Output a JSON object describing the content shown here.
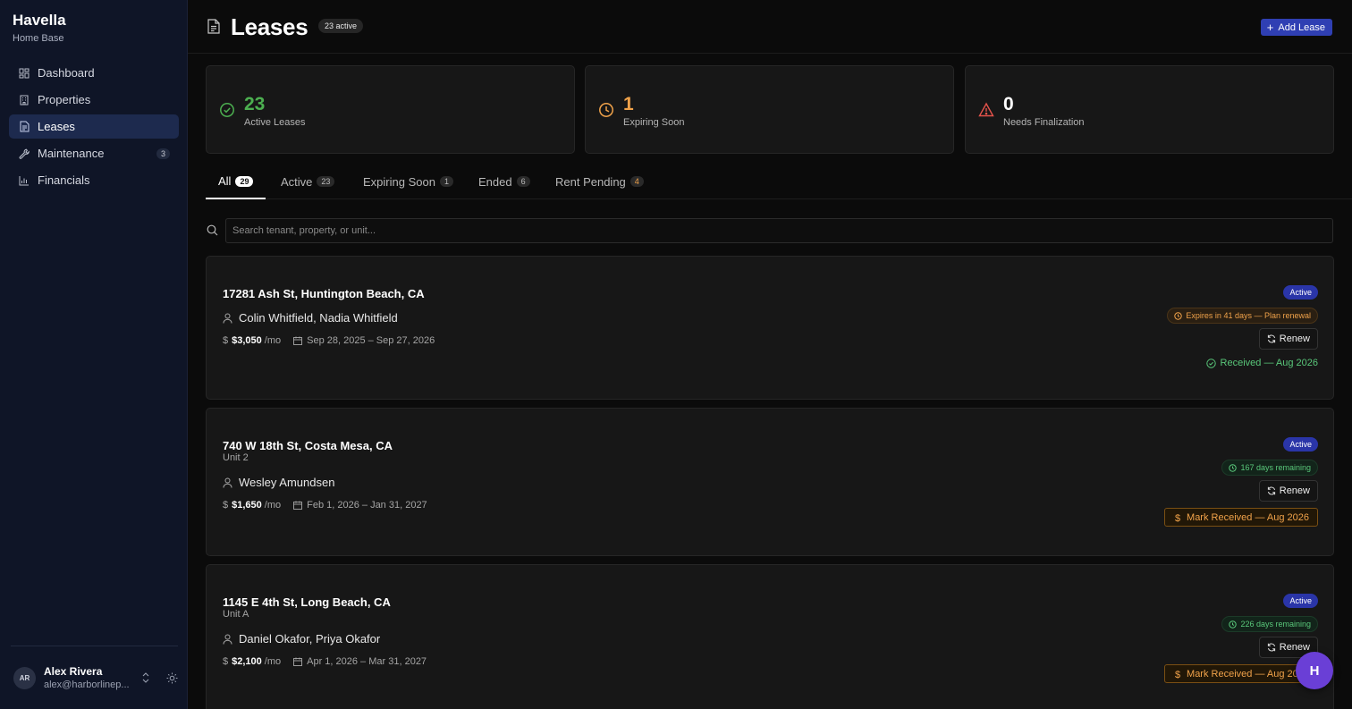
{
  "brand": {
    "name": "Havella",
    "subtitle": "Home Base"
  },
  "sidebar": {
    "items": [
      {
        "label": "Dashboard",
        "icon": "dashboard-icon",
        "active": false
      },
      {
        "label": "Properties",
        "icon": "building-icon",
        "active": false
      },
      {
        "label": "Leases",
        "icon": "document-icon",
        "active": true
      },
      {
        "label": "Maintenance",
        "icon": "wrench-icon",
        "active": false,
        "count": "3"
      },
      {
        "label": "Financials",
        "icon": "chart-icon",
        "active": false
      }
    ],
    "user": {
      "initials": "AR",
      "name": "Alex Rivera",
      "email": "alex@harborlinep..."
    }
  },
  "header": {
    "title": "Leases",
    "badge": "23 active",
    "add_label": "Add Lease"
  },
  "stats": [
    {
      "value": "23",
      "label": "Active Leases",
      "color": "#4caf50",
      "icon": "check-circle-icon"
    },
    {
      "value": "1",
      "label": "Expiring Soon",
      "color": "#f0a24a",
      "icon": "clock-icon"
    },
    {
      "value": "0",
      "label": "Needs Finalization",
      "color": "#ffffff",
      "icon": "warning-icon"
    }
  ],
  "tabs": [
    {
      "label": "All",
      "count": "29"
    },
    {
      "label": "Active",
      "count": "23"
    },
    {
      "label": "Expiring Soon",
      "count": "1"
    },
    {
      "label": "Ended",
      "count": "6"
    },
    {
      "label": "Rent Pending",
      "count": "4"
    }
  ],
  "search": {
    "placeholder": "Search tenant, property, or unit..."
  },
  "leases": [
    {
      "address": "17281 Ash St, Huntington Beach, CA",
      "unit": "",
      "tenants": "Colin Whitfield, Nadia Whitfield",
      "rent": "$3,050",
      "per": "/mo",
      "dates": "Sep 28, 2025 – Sep 27, 2026",
      "status": "Active",
      "expiry": "Expires in 41 days — Plan renewal",
      "renew": "Renew",
      "payment": "Received — Aug 2026"
    },
    {
      "address": "740 W 18th St, Costa Mesa, CA",
      "unit": "Unit 2",
      "tenants": "Wesley Amundsen",
      "rent": "$1,650",
      "per": "/mo",
      "dates": "Feb 1, 2026 – Jan 31, 2027",
      "status": "Active",
      "expiry": "167 days remaining",
      "renew": "Renew",
      "payment": "Mark Received — Aug 2026"
    },
    {
      "address": "1145 E 4th St, Long Beach, CA",
      "unit": "Unit A",
      "tenants": "Daniel Okafor, Priya Okafor",
      "rent": "$2,100",
      "per": "/mo",
      "dates": "Apr 1, 2026 – Mar 31, 2027",
      "status": "Active",
      "expiry": "226 days remaining",
      "renew": "Renew",
      "payment": "Mark Received — Aug 2026"
    }
  ],
  "fab": {
    "label": "H"
  }
}
